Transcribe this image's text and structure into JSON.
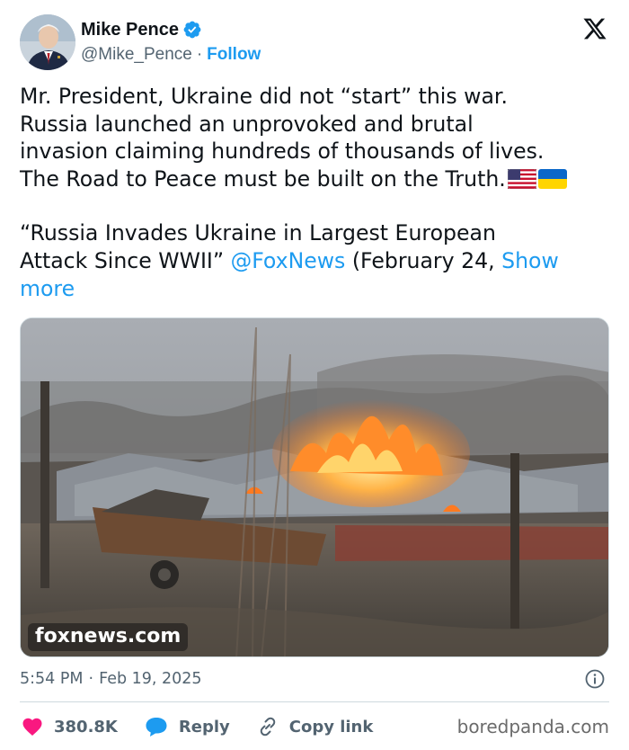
{
  "author": {
    "name": "Mike Pence",
    "handle": "@Mike_Pence",
    "separator": "·",
    "follow_label": "Follow",
    "verified_color": "#1d9bf0"
  },
  "icons": {
    "platform_logo": "x-logo-icon",
    "verified": "verified-badge-icon",
    "info": "info-icon",
    "like": "heart-icon",
    "reply": "speech-bubble-icon",
    "copy": "link-icon"
  },
  "tweet": {
    "lines": [
      "Mr. President, Ukraine did not “start” this war.",
      "Russia launched an unprovoked and brutal",
      "invasion claiming hundreds of thousands of lives.",
      "The Road to Peace must be built on the Truth."
    ],
    "quote_line1": "“Russia Invades Ukraine in Largest European",
    "quote_line2_prefix": "Attack Since WWII” ",
    "mention": "@FoxNews",
    "quote_line2_suffix": " (February 24, ",
    "show_more_a": "Show",
    "show_more_b": "more",
    "emoji": [
      "us-flag",
      "ukraine-flag"
    ]
  },
  "media": {
    "watermark": "foxnews.com"
  },
  "meta": {
    "time": "5:54 PM",
    "separator": "·",
    "date": "Feb 19, 2025"
  },
  "actions": {
    "likes": "380.8K",
    "reply_label": "Reply",
    "copy_label": "Copy link"
  },
  "source_watermark": "boredpanda.com",
  "colors": {
    "accent": "#1d9bf0",
    "like": "#f91880",
    "text": "#0f1419",
    "muted": "#536471"
  }
}
